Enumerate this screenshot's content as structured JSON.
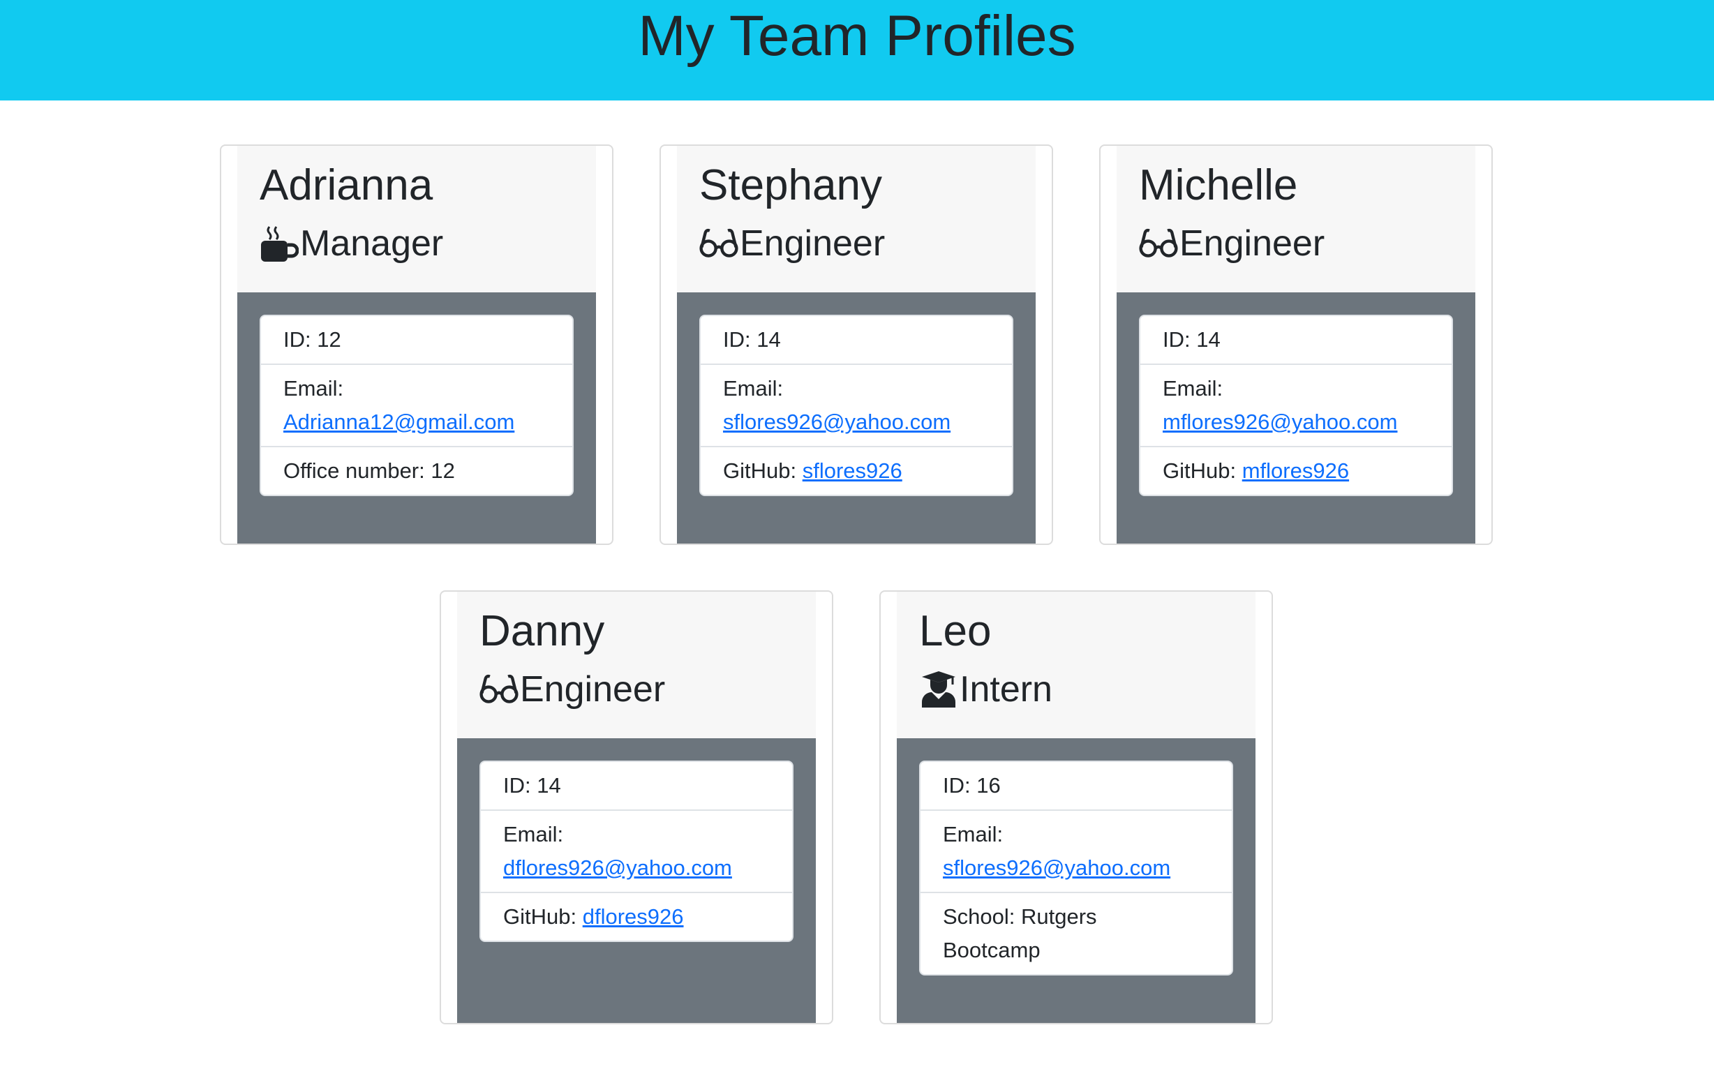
{
  "header": {
    "title": "My Team Profiles"
  },
  "team": [
    {
      "name": "Adrianna",
      "role": "Manager",
      "icon": "mug-hot-icon",
      "id_text": "ID: 12",
      "email_label": "Email:",
      "email": "Adrianna12@gmail.com",
      "extra_label": "Office number: 12",
      "extra_link": ""
    },
    {
      "name": "Stephany",
      "role": "Engineer",
      "icon": "glasses-icon",
      "id_text": "ID: 14",
      "email_label": "Email:",
      "email": "sflores926@yahoo.com",
      "extra_label": "GitHub: ",
      "extra_link": "sflores926"
    },
    {
      "name": "Michelle",
      "role": "Engineer",
      "icon": "glasses-icon",
      "id_text": "ID: 14",
      "email_label": "Email:",
      "email": "mflores926@yahoo.com",
      "extra_label": "GitHub: ",
      "extra_link": "mflores926"
    },
    {
      "name": "Danny",
      "role": "Engineer",
      "icon": "glasses-icon",
      "id_text": "ID: 14",
      "email_label": "Email:",
      "email": "dflores926@yahoo.com",
      "extra_label": "GitHub: ",
      "extra_link": "dflores926"
    },
    {
      "name": "Leo",
      "role": "Intern",
      "icon": "graduate-icon",
      "id_text": "ID: 16",
      "email_label": "Email:",
      "email": "sflores926@yahoo.com",
      "extra_label": "School: Rutgers Bootcamp",
      "extra_link": ""
    }
  ],
  "colors": {
    "header_bg": "#11caf0",
    "card_body_bg": "#6c757d",
    "card_head_bg": "#f7f7f7",
    "link": "#0d6efd"
  }
}
